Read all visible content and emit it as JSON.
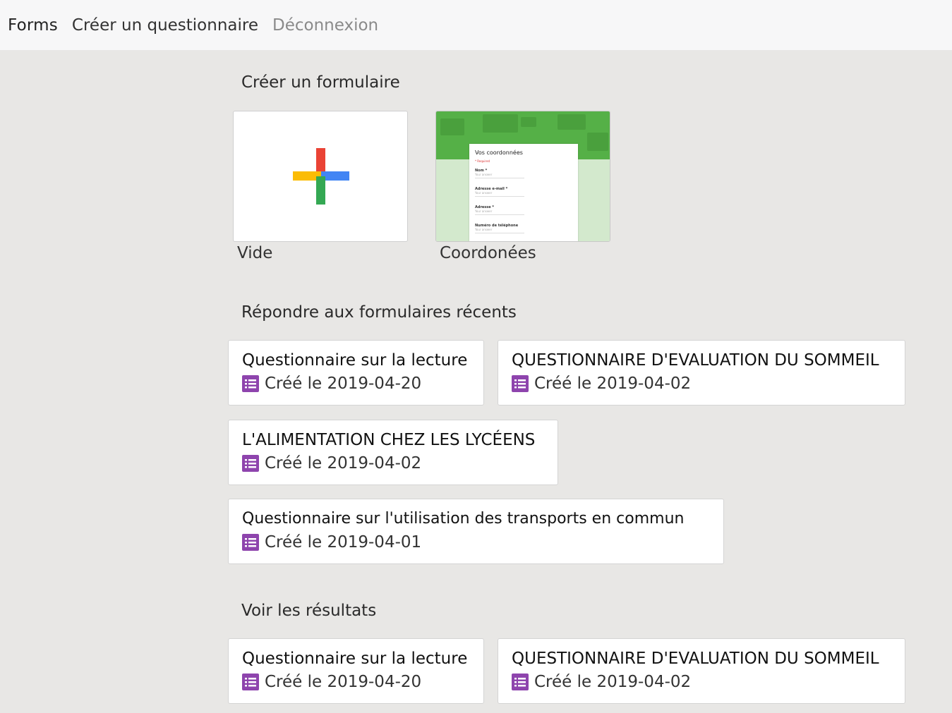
{
  "nav": {
    "brand": "Forms",
    "create": "Créer un questionnaire",
    "logout": "Déconnexion"
  },
  "sections": {
    "create": "Créer un formulaire",
    "recent": "Répondre aux formulaires récents",
    "results": "Voir les résultats"
  },
  "templates": [
    {
      "label": "Vide",
      "icon": "plus-icon"
    },
    {
      "label": "Coordonées",
      "preview": {
        "title": "Vos coordonnées",
        "required_note": "* Required",
        "fields": [
          "Nom *",
          "Adresse e-mail *",
          "Adresse *",
          "Numéro de téléphone"
        ],
        "answer_placeholder": "Your answer"
      }
    }
  ],
  "recent_forms": [
    {
      "title": "Questionnaire sur la lecture",
      "date": "Créé le 2019-04-20"
    },
    {
      "title": "QUESTIONNAIRE D'EVALUATION DU SOMMEIL",
      "date": "Créé le 2019-04-02"
    },
    {
      "title": "L'ALIMENTATION CHEZ LES LYCÉENS",
      "date": "Créé le 2019-04-02"
    },
    {
      "title": "Questionnaire sur l'utilisation des transports en commun",
      "date": "Créé le 2019-04-01"
    }
  ],
  "result_forms": [
    {
      "title": "Questionnaire sur la lecture",
      "date": "Créé le 2019-04-20"
    },
    {
      "title": "QUESTIONNAIRE D'EVALUATION DU SOMMEIL",
      "date": "Créé le 2019-04-02"
    }
  ],
  "colors": {
    "background": "#e8e7e5",
    "navbar": "#f7f7f8",
    "forms_icon": "#8e44ad",
    "plus_red": "#ea4335",
    "plus_blue": "#4285f4",
    "plus_yellow": "#fbbc05",
    "plus_green": "#34a853"
  }
}
